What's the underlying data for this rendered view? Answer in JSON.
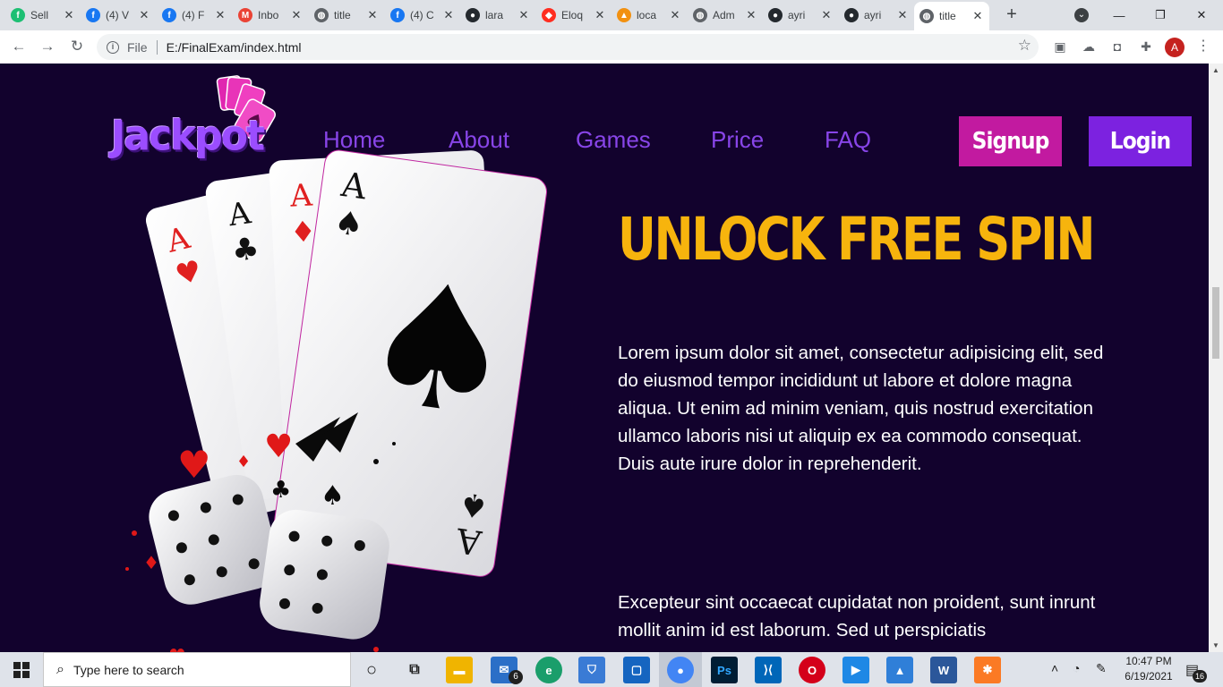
{
  "browser": {
    "tabs": [
      {
        "title": "Sell",
        "icon": "fiverr-icon",
        "color": "#1dbf73",
        "glyph": "f"
      },
      {
        "title": "(4) V",
        "icon": "facebook-icon",
        "color": "#1877f2",
        "glyph": "f"
      },
      {
        "title": "(4) F",
        "icon": "facebook-icon",
        "color": "#1877f2",
        "glyph": "f"
      },
      {
        "title": "Inbo",
        "icon": "gmail-icon",
        "color": "#ea4335",
        "glyph": "M"
      },
      {
        "title": "title",
        "icon": "globe-icon",
        "color": "#5f6368",
        "glyph": "◍"
      },
      {
        "title": "(4) C",
        "icon": "facebook-icon",
        "color": "#1877f2",
        "glyph": "f"
      },
      {
        "title": "lara",
        "icon": "github-icon",
        "color": "#24292e",
        "glyph": "●"
      },
      {
        "title": "Eloq",
        "icon": "laravel-icon",
        "color": "#ff2d20",
        "glyph": "◆"
      },
      {
        "title": "loca",
        "icon": "phpmyadmin-icon",
        "color": "#f29111",
        "glyph": "▲"
      },
      {
        "title": "Adm",
        "icon": "globe-icon",
        "color": "#5f6368",
        "glyph": "◍"
      },
      {
        "title": "ayri",
        "icon": "github-icon",
        "color": "#24292e",
        "glyph": "●"
      },
      {
        "title": "ayri",
        "icon": "github-icon",
        "color": "#24292e",
        "glyph": "●"
      },
      {
        "title": "title",
        "icon": "globe-icon",
        "color": "#5f6368",
        "glyph": "◍",
        "active": true
      }
    ],
    "close_glyph": "✕",
    "new_tab_glyph": "+",
    "window_controls": {
      "tab_search": "⌄",
      "minimize": "—",
      "maximize": "❐",
      "close": "✕"
    },
    "address": {
      "scheme_label": "File",
      "url": "E:/FinalExam/index.html"
    },
    "nav": {
      "back": "←",
      "forward": "→",
      "reload": "↻"
    },
    "profile_initial": "A"
  },
  "site": {
    "logo": "Jackpot",
    "nav": [
      "Home",
      "About",
      "Games",
      "Price",
      "FAQ"
    ],
    "signup": "Signup",
    "login": "Login",
    "headline": "UNLOCK FREE SPIN",
    "paragraphs": [
      "Lorem ipsum dolor sit amet, consectetur adipisicing elit, sed do eiusmod tempor incididunt ut labore et dolore magna aliqua. Ut enim ad minim veniam, quis nostrud exercitation ullamco laboris nisi ut aliquip ex ea commodo consequat. Duis aute irure dolor in reprehenderit.",
      "Excepteur sint occaecat cupidatat non proident, sunt inrunt mollit anim id est laborum. Sed ut perspiciatis"
    ],
    "colors": {
      "background": "#12022d",
      "nav": "#8845e8",
      "headline": "#f7b40d",
      "signup": "#c21aa0",
      "login": "#7c22e0"
    }
  },
  "taskbar": {
    "search_placeholder": "Type here to search",
    "mail_badge": "6",
    "time": "10:47 PM",
    "date": "6/19/2021",
    "notification_count": "16"
  }
}
